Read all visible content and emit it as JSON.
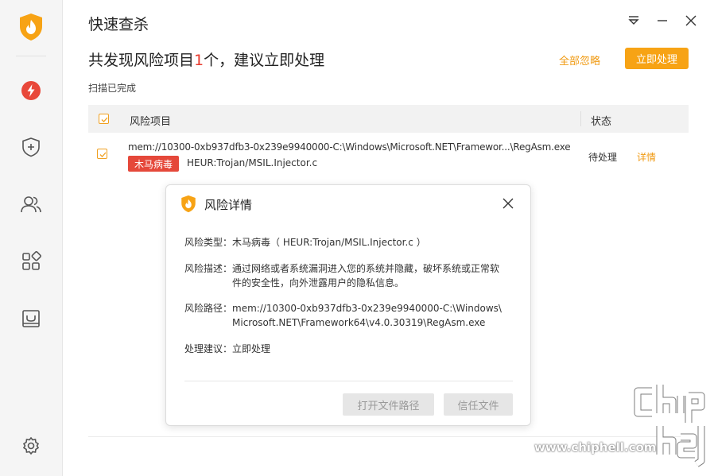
{
  "app": {
    "title": "快速查杀"
  },
  "sidebar": {
    "items": [
      {
        "icon": "bolt-icon",
        "color": "#e8483a"
      },
      {
        "icon": "shield-plus-icon"
      },
      {
        "icon": "users-icon"
      },
      {
        "icon": "apps-icon"
      },
      {
        "icon": "inbox-icon"
      }
    ],
    "settings_icon": "gear-icon"
  },
  "header": {
    "headline_prefix": "共发现风险项目",
    "risk_count": "1",
    "headline_suffix": "个，建议立即处理",
    "ignore_all": "全部忽略",
    "handle_now": "立即处理",
    "scan_status": "扫描已完成"
  },
  "table": {
    "columns": [
      "风险项目",
      "状态"
    ],
    "rows": [
      {
        "path": "mem://10300-0xb937dfb3-0x239e9940000-C:\\Windows\\Microsoft.NET\\Framewor...\\RegAsm.exe",
        "category": "木马病毒",
        "virus": "HEUR:Trojan/MSIL.Injector.c",
        "status": "待处理",
        "action": "详情"
      }
    ]
  },
  "dialog": {
    "title": "风险详情",
    "type_label": "风险类型：",
    "type_value": "木马病毒（ HEUR:Trojan/MSIL.Injector.c ）",
    "desc_label": "风险描述：",
    "desc_value": "通过网络或者系统漏洞进入您的系统并隐藏，破坏系统或正常软件的安全性，向外泄露用户的隐私信息。",
    "path_label": "风险路径：",
    "path_value_line1": "mem://10300-0xb937dfb3-0x239e9940000-C:\\Windows\\",
    "path_value_line2": "Microsoft.NET\\Framework64\\v4.0.30319\\RegAsm.exe",
    "advice_label": "处理建议：",
    "advice_value": "立即处理",
    "open_path_button": "打开文件路径",
    "trust_button": "信任文件"
  },
  "watermark": {
    "text": "www.chiphell.com"
  },
  "colors": {
    "accent": "#f7a315",
    "danger": "#e5483a",
    "link": "#f09a12"
  }
}
